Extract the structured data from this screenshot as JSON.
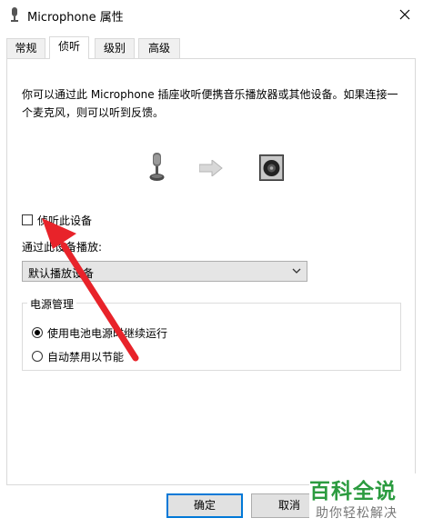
{
  "window": {
    "title": "Microphone 属性",
    "close_symbol": "✕"
  },
  "tabs": [
    {
      "label": "常规",
      "active": false
    },
    {
      "label": "侦听",
      "active": true
    },
    {
      "label": "级别",
      "active": false
    },
    {
      "label": "高级",
      "active": false
    }
  ],
  "listen": {
    "description": "你可以通过此 Microphone 插座收听便携音乐播放器或其他设备。如果连接一个麦克风，则可以听到反馈。",
    "checkbox_label": "侦听此设备",
    "checkbox_checked": false,
    "playback_label": "通过此设备播放:",
    "playback_value": "默认播放设备"
  },
  "power": {
    "group_label": "电源管理",
    "options": [
      {
        "label": "使用电池电源时继续运行",
        "selected": true
      },
      {
        "label": "自动禁用以节能",
        "selected": false
      }
    ]
  },
  "buttons": {
    "ok": "确定",
    "cancel": "取消"
  },
  "watermark": {
    "logo": "百科全说",
    "slogan": "助你轻松解决"
  },
  "colors": {
    "accent": "#0078d7",
    "annotation": "#e8232a",
    "watermark_green": "#2b9b3f"
  }
}
